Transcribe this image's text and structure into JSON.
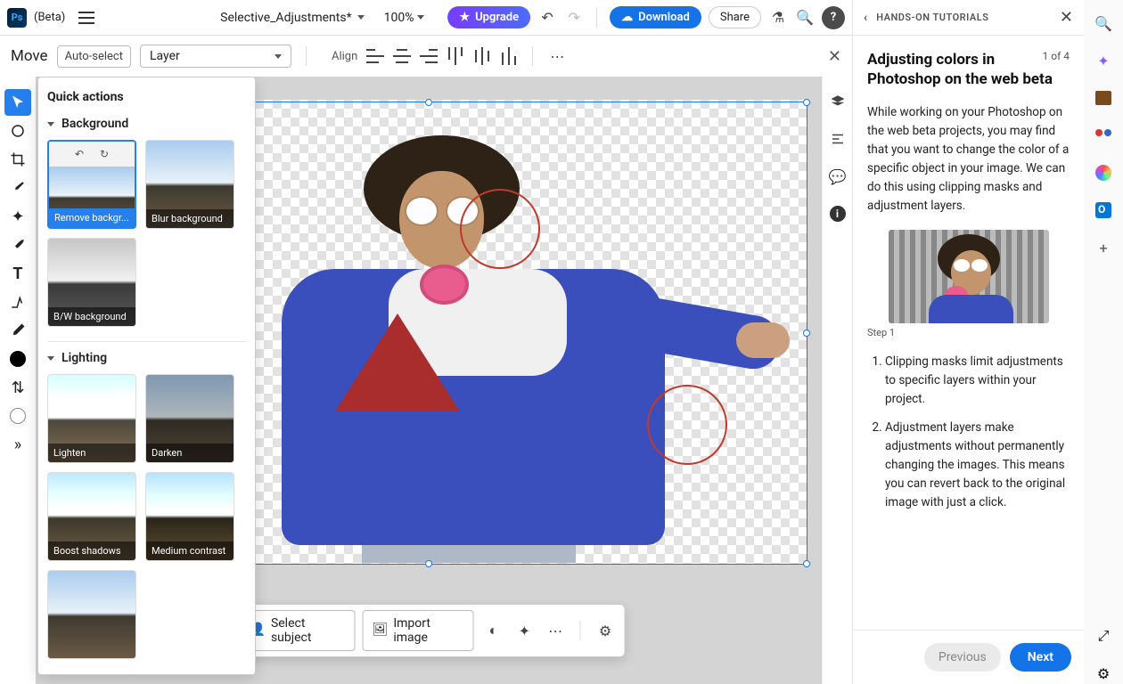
{
  "header": {
    "logo_text": "Ps",
    "beta_label": "(Beta)",
    "doc_title": "Selective_Adjustments*",
    "zoom": "100%",
    "upgrade": "Upgrade",
    "download": "Download",
    "share": "Share"
  },
  "options_bar": {
    "tool": "Move",
    "auto_select": "Auto-select",
    "target": "Layer",
    "align_label": "Align"
  },
  "left_tools": [
    {
      "name": "move-tool",
      "active": true
    },
    {
      "name": "object-select-tool"
    },
    {
      "name": "crop-tool"
    },
    {
      "name": "eyedropper-tool"
    },
    {
      "name": "spot-heal-tool"
    },
    {
      "name": "brush-tool"
    },
    {
      "name": "text-tool"
    },
    {
      "name": "layer-add-tool"
    },
    {
      "name": "color-sampler-tool"
    },
    {
      "name": "foreground-color"
    },
    {
      "name": "swap-colors"
    },
    {
      "name": "background-color"
    },
    {
      "name": "more-tools"
    }
  ],
  "quick_actions": {
    "title": "Quick actions",
    "sections": [
      {
        "name": "Background",
        "items": [
          {
            "label": "Remove backgr...",
            "selected": true
          },
          {
            "label": "Blur background"
          },
          {
            "label": "B/W background"
          }
        ]
      },
      {
        "name": "Lighting",
        "items": [
          {
            "label": "Lighten"
          },
          {
            "label": "Darken"
          },
          {
            "label": "Boost shadows"
          },
          {
            "label": "Medium contrast"
          }
        ]
      }
    ]
  },
  "action_bar": {
    "select_subject": "Select subject",
    "import_image": "Import image"
  },
  "right_strip_icons": [
    "layers-icon",
    "properties-icon",
    "comments-icon",
    "info-icon"
  ],
  "tutorial": {
    "back_label": "HANDS-ON TUTORIALS",
    "counter": "1 of 4",
    "title": "Adjusting colors in Photoshop on the web beta",
    "paragraph": "While working on your Photoshop on the web beta projects, you may find that you want to change the color of a specific object in your image. We can do this using clipping masks and adjustment layers.",
    "step_label": "Step 1",
    "list": [
      "Clipping masks limit adjustments to specific layers within your project.",
      "Adjustment layers make adjustments without permanently changing the images. This means you can revert back to the original image with just a click."
    ],
    "prev": "Previous",
    "next": "Next"
  },
  "side_dock": [
    "search-icon",
    "ai-icon",
    "briefcase-icon",
    "people-icon",
    "copilot-icon",
    "outlook-icon",
    "add-icon",
    "expand-icon",
    "settings-icon"
  ]
}
